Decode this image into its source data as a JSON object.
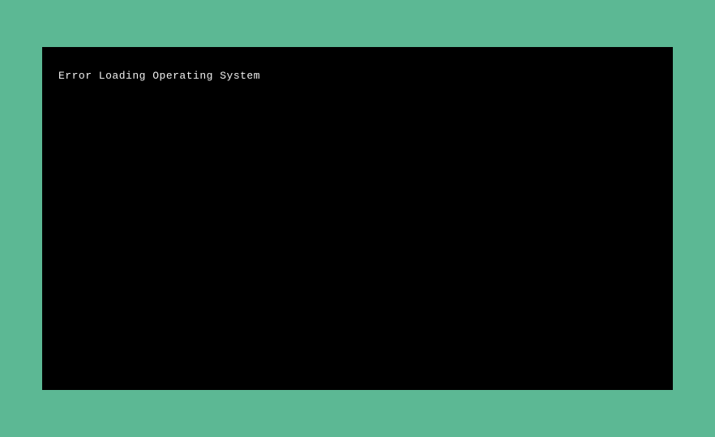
{
  "boot": {
    "error_message": "Error Loading Operating System"
  }
}
